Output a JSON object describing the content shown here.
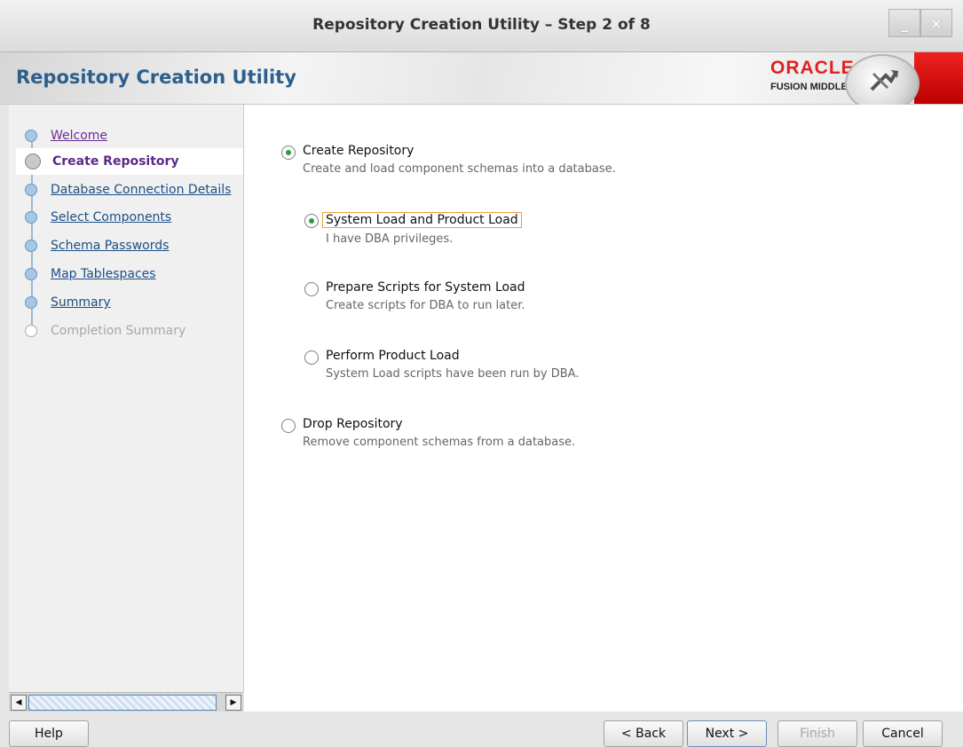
{
  "window": {
    "title": "Repository Creation Utility – Step 2 of 8",
    "minimize_glyph": "_",
    "close_glyph": "×"
  },
  "header": {
    "app_title": "Repository Creation Utility",
    "brand": "ORACLE",
    "brand_sub": "FUSION MIDDLEWARE",
    "brand_color": "#dd2222"
  },
  "nav": {
    "items": [
      {
        "label": "Welcome",
        "state": "visited"
      },
      {
        "label": "Create Repository",
        "state": "active"
      },
      {
        "label": "Database Connection Details",
        "state": "link"
      },
      {
        "label": "Select Components",
        "state": "link"
      },
      {
        "label": "Schema Passwords",
        "state": "link"
      },
      {
        "label": "Map Tablespaces",
        "state": "link"
      },
      {
        "label": "Summary",
        "state": "link"
      },
      {
        "label": "Completion Summary",
        "state": "disabled"
      }
    ]
  },
  "main": {
    "create": {
      "label": "Create Repository",
      "desc": "Create and load component schemas into a database.",
      "selected": true
    },
    "system_product": {
      "label": "System Load and Product Load",
      "desc": "I have DBA privileges.",
      "selected": true
    },
    "prepare_scripts": {
      "label": "Prepare Scripts for System Load",
      "desc": "Create scripts for DBA to run later.",
      "selected": false
    },
    "product_load": {
      "label": "Perform Product Load",
      "desc": "System Load scripts have been run by DBA.",
      "selected": false
    },
    "drop": {
      "label": "Drop Repository",
      "desc": "Remove component schemas from a database.",
      "selected": false
    }
  },
  "footer": {
    "help": "Help",
    "back": "< Back",
    "next": "Next >",
    "finish": "Finish",
    "cancel": "Cancel"
  },
  "colors": {
    "accent": "#2d5f8c",
    "radio_selected": "#2f9a3a",
    "focus_border": "#e8a23c"
  }
}
